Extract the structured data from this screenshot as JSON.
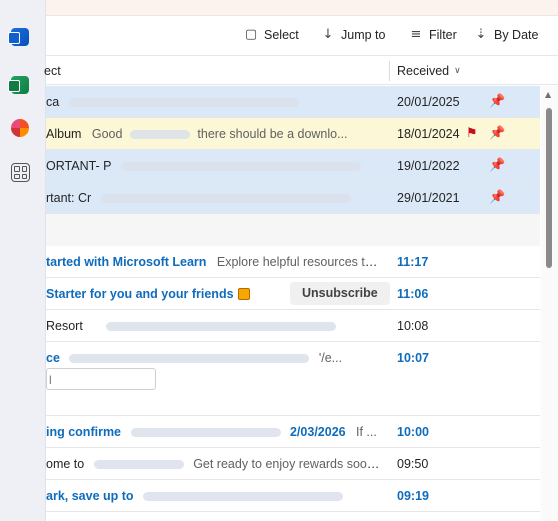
{
  "toolbar": {
    "select_label": "Select",
    "jump_label": "Jump to",
    "filter_label": "Filter",
    "sort_label": "By Date",
    "select_icon": "select-icon",
    "jump_icon": "down-arrow-icon",
    "filter_icon": "filter-icon",
    "sort_icon": "sort-icon"
  },
  "columns": {
    "subject": "ect",
    "received": "Received"
  },
  "pinned_rows": [
    {
      "subject": "ca",
      "preview": "",
      "date": "20/01/2025",
      "pinned": true,
      "flagged": false
    },
    {
      "subject": "Album",
      "preview": "Good",
      "preview_tail": "there should be a downlo...",
      "date": "18/01/2024",
      "pinned": true,
      "flagged": true
    },
    {
      "subject": "ORTANT- P",
      "preview": "",
      "date": "19/01/2022",
      "pinned": true,
      "flagged": false
    },
    {
      "subject": "rtant: Cr",
      "preview": "",
      "date": "29/01/2021",
      "pinned": true,
      "flagged": false
    }
  ],
  "rows": [
    {
      "subject": "tarted with Microsoft Learn",
      "preview": "Explore helpful resources to kic...",
      "time": "11:17"
    },
    {
      "subject": "Starter for you and your friends",
      "unsubscribe": "Unsubscribe",
      "time": "11:06"
    },
    {
      "subject": "Resort",
      "preview": "",
      "time": "10:08"
    },
    {
      "subject": "ce",
      "preview": "'/e...",
      "time": "10:07",
      "input_text": "l"
    },
    {
      "subject": "ing confirme",
      "preview_date": "2/03/2026",
      "preview": "If ...",
      "time": "10:00"
    },
    {
      "subject": "ome to",
      "preview": "Get ready to enjoy rewards soon...",
      "time": "09:50"
    },
    {
      "subject": "ark, save up to",
      "preview": "",
      "time": "09:19"
    }
  ],
  "rail": {
    "icons": [
      "outlook-icon",
      "excel-icon",
      "office-icon",
      "apps-icon"
    ]
  },
  "colors": {
    "accent": "#0f6cbd",
    "pinned_bg": "#dbe8f8",
    "highlight_bg": "#fcf7d6",
    "flag": "#c50f1f"
  }
}
